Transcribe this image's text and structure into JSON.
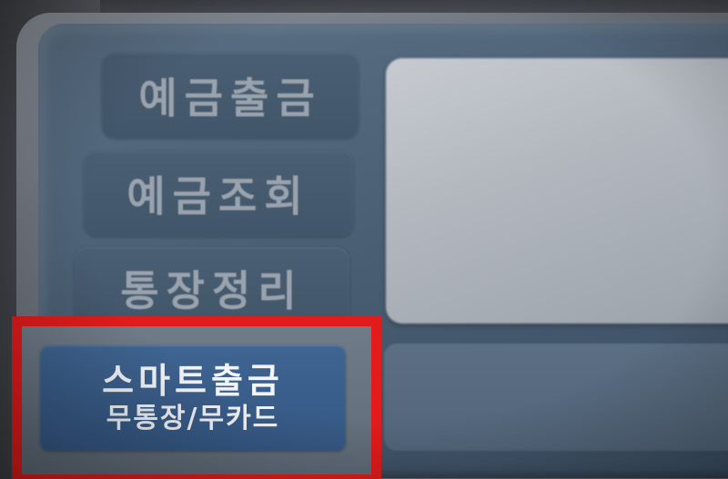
{
  "menu": {
    "items": [
      {
        "label": "예금출금"
      },
      {
        "label": "예금조회"
      },
      {
        "label": "통장정리"
      }
    ],
    "highlighted": {
      "title": "스마트출금",
      "subtitle": "무통장/무카드"
    }
  },
  "colors": {
    "highlight_border": "#e21b1b",
    "highlighted_button": "#3f6491",
    "menu_button": "#4b5f74",
    "screen_background": "#4e6378",
    "display_panel": "#b3b8bf"
  }
}
